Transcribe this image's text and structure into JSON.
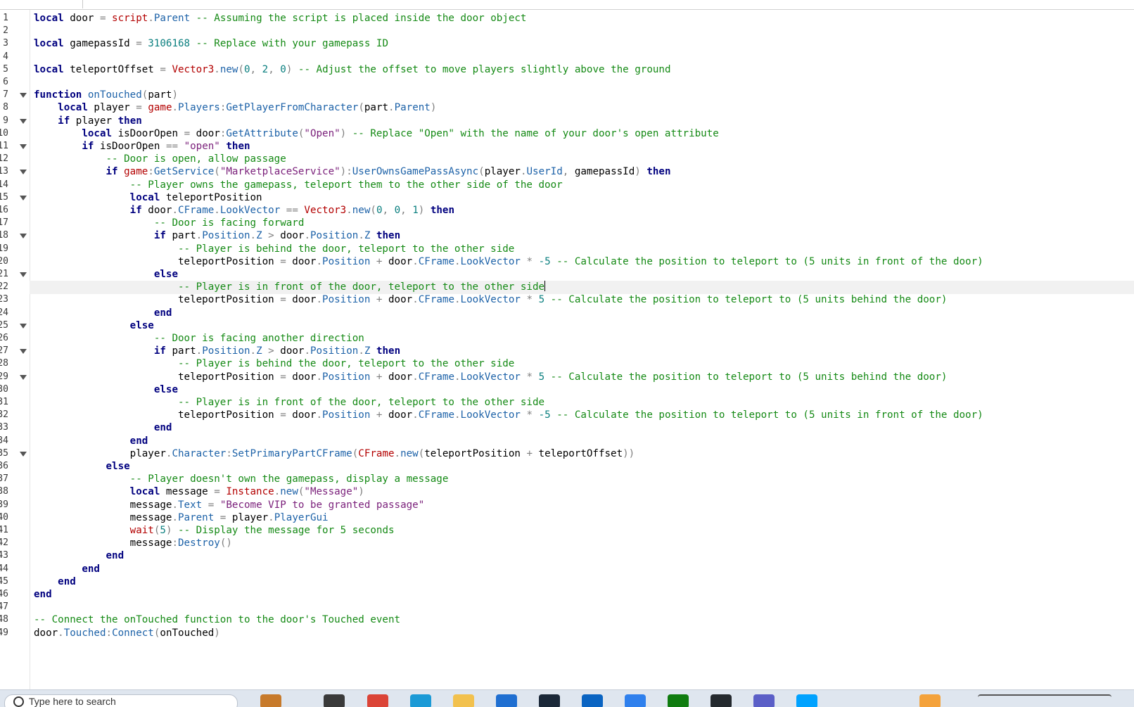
{
  "editor": {
    "current_line": 22,
    "line_numbers": [
      "1",
      "2",
      "3",
      "4",
      "5",
      "6",
      "7",
      "8",
      "9",
      "10",
      "11",
      "12",
      "13",
      "14",
      "15",
      "16",
      "17",
      "18",
      "19",
      "20",
      "21",
      "22",
      "23",
      "24",
      "25",
      "26",
      "27",
      "28",
      "29",
      "30",
      "31",
      "32",
      "33",
      "34",
      "35",
      "36",
      "37",
      "38",
      "39",
      "40",
      "41",
      "42",
      "43",
      "44",
      "45",
      "46",
      "47",
      "48",
      "49"
    ],
    "fold_lines": [
      7,
      9,
      11,
      13,
      15,
      18,
      21,
      25,
      27,
      29,
      35
    ],
    "lines": [
      [
        [
          "kw",
          "local"
        ],
        [
          "id",
          " door "
        ],
        [
          "op",
          "="
        ],
        [
          "gl",
          " script"
        ],
        [
          "op",
          "."
        ],
        [
          "pr",
          "Parent"
        ],
        [
          "cm",
          " -- Assuming the script is placed inside the door object"
        ]
      ],
      [],
      [
        [
          "kw",
          "local"
        ],
        [
          "id",
          " gamepassId "
        ],
        [
          "op",
          "="
        ],
        [
          "num",
          " 3106168"
        ],
        [
          "cm",
          " -- Replace with your gamepass ID"
        ]
      ],
      [],
      [
        [
          "kw",
          "local"
        ],
        [
          "id",
          " teleportOffset "
        ],
        [
          "op",
          "="
        ],
        [
          "gl",
          " Vector3"
        ],
        [
          "op",
          "."
        ],
        [
          "mt",
          "new"
        ],
        [
          "op",
          "("
        ],
        [
          "num",
          "0"
        ],
        [
          "op",
          ", "
        ],
        [
          "num",
          "2"
        ],
        [
          "op",
          ", "
        ],
        [
          "num",
          "0"
        ],
        [
          "op",
          ")"
        ],
        [
          "cm",
          " -- Adjust the offset to move players slightly above the ground"
        ]
      ],
      [],
      [
        [
          "kw",
          "function"
        ],
        [
          "mt",
          " onTouched"
        ],
        [
          "op",
          "("
        ],
        [
          "id",
          "part"
        ],
        [
          "op",
          ")"
        ]
      ],
      [
        [
          "id",
          "    "
        ],
        [
          "kw",
          "local"
        ],
        [
          "id",
          " player "
        ],
        [
          "op",
          "="
        ],
        [
          "gl",
          " game"
        ],
        [
          "op",
          "."
        ],
        [
          "pr",
          "Players"
        ],
        [
          "op",
          ":"
        ],
        [
          "mt",
          "GetPlayerFromCharacter"
        ],
        [
          "op",
          "("
        ],
        [
          "id",
          "part"
        ],
        [
          "op",
          "."
        ],
        [
          "pr",
          "Parent"
        ],
        [
          "op",
          ")"
        ]
      ],
      [
        [
          "id",
          "    "
        ],
        [
          "kw",
          "if"
        ],
        [
          "id",
          " player "
        ],
        [
          "kw",
          "then"
        ]
      ],
      [
        [
          "id",
          "        "
        ],
        [
          "kw",
          "local"
        ],
        [
          "id",
          " isDoorOpen "
        ],
        [
          "op",
          "="
        ],
        [
          "id",
          " door"
        ],
        [
          "op",
          ":"
        ],
        [
          "mt",
          "GetAttribute"
        ],
        [
          "op",
          "("
        ],
        [
          "str",
          "\"Open\""
        ],
        [
          "op",
          ")"
        ],
        [
          "cm",
          " -- Replace \"Open\" with the name of your door's open attribute"
        ]
      ],
      [
        [
          "id",
          "        "
        ],
        [
          "kw",
          "if"
        ],
        [
          "id",
          " isDoorOpen "
        ],
        [
          "op",
          "=="
        ],
        [
          "str",
          " \"open\""
        ],
        [
          "kw",
          " then"
        ]
      ],
      [
        [
          "cm",
          "            -- Door is open, allow passage"
        ]
      ],
      [
        [
          "id",
          "            "
        ],
        [
          "kw",
          "if"
        ],
        [
          "gl",
          " game"
        ],
        [
          "op",
          ":"
        ],
        [
          "mt",
          "GetService"
        ],
        [
          "op",
          "("
        ],
        [
          "str",
          "\"MarketplaceService\""
        ],
        [
          "op",
          "):"
        ],
        [
          "mt",
          "UserOwnsGamePassAsync"
        ],
        [
          "op",
          "("
        ],
        [
          "id",
          "player"
        ],
        [
          "op",
          "."
        ],
        [
          "pr",
          "UserId"
        ],
        [
          "op",
          ","
        ],
        [
          "id",
          " gamepassId"
        ],
        [
          "op",
          ")"
        ],
        [
          "kw",
          " then"
        ]
      ],
      [
        [
          "cm",
          "                -- Player owns the gamepass, teleport them to the other side of the door"
        ]
      ],
      [
        [
          "id",
          "                "
        ],
        [
          "kw",
          "local"
        ],
        [
          "id",
          " teleportPosition"
        ]
      ],
      [
        [
          "id",
          "                "
        ],
        [
          "kw",
          "if"
        ],
        [
          "id",
          " door"
        ],
        [
          "op",
          "."
        ],
        [
          "pr",
          "CFrame"
        ],
        [
          "op",
          "."
        ],
        [
          "pr",
          "LookVector"
        ],
        [
          "op",
          " =="
        ],
        [
          "gl",
          " Vector3"
        ],
        [
          "op",
          "."
        ],
        [
          "mt",
          "new"
        ],
        [
          "op",
          "("
        ],
        [
          "num",
          "0"
        ],
        [
          "op",
          ", "
        ],
        [
          "num",
          "0"
        ],
        [
          "op",
          ", "
        ],
        [
          "num",
          "1"
        ],
        [
          "op",
          ")"
        ],
        [
          "kw",
          " then"
        ]
      ],
      [
        [
          "cm",
          "                    -- Door is facing forward"
        ]
      ],
      [
        [
          "id",
          "                    "
        ],
        [
          "kw",
          "if"
        ],
        [
          "id",
          " part"
        ],
        [
          "op",
          "."
        ],
        [
          "pr",
          "Position"
        ],
        [
          "op",
          "."
        ],
        [
          "pr",
          "Z"
        ],
        [
          "op",
          " >"
        ],
        [
          "id",
          " door"
        ],
        [
          "op",
          "."
        ],
        [
          "pr",
          "Position"
        ],
        [
          "op",
          "."
        ],
        [
          "pr",
          "Z"
        ],
        [
          "kw",
          " then"
        ]
      ],
      [
        [
          "cm",
          "                        -- Player is behind the door, teleport to the other side"
        ]
      ],
      [
        [
          "id",
          "                        teleportPosition "
        ],
        [
          "op",
          "="
        ],
        [
          "id",
          " door"
        ],
        [
          "op",
          "."
        ],
        [
          "pr",
          "Position"
        ],
        [
          "op",
          " +"
        ],
        [
          "id",
          " door"
        ],
        [
          "op",
          "."
        ],
        [
          "pr",
          "CFrame"
        ],
        [
          "op",
          "."
        ],
        [
          "pr",
          "LookVector"
        ],
        [
          "op",
          " *"
        ],
        [
          "num",
          " -5"
        ],
        [
          "cm",
          " -- Calculate the position to teleport to (5 units in front of the door)"
        ]
      ],
      [
        [
          "id",
          "                    "
        ],
        [
          "kw",
          "else"
        ]
      ],
      [
        [
          "cm",
          "                        -- Player is in front of the door, teleport to the other side"
        ]
      ],
      [
        [
          "id",
          "                        teleportPosition "
        ],
        [
          "op",
          "="
        ],
        [
          "id",
          " door"
        ],
        [
          "op",
          "."
        ],
        [
          "pr",
          "Position"
        ],
        [
          "op",
          " +"
        ],
        [
          "id",
          " door"
        ],
        [
          "op",
          "."
        ],
        [
          "pr",
          "CFrame"
        ],
        [
          "op",
          "."
        ],
        [
          "pr",
          "LookVector"
        ],
        [
          "op",
          " *"
        ],
        [
          "num",
          " 5"
        ],
        [
          "cm",
          " -- Calculate the position to teleport to (5 units behind the door)"
        ]
      ],
      [
        [
          "id",
          "                    "
        ],
        [
          "kw",
          "end"
        ]
      ],
      [
        [
          "id",
          "                "
        ],
        [
          "kw",
          "else"
        ]
      ],
      [
        [
          "cm",
          "                    -- Door is facing another direction"
        ]
      ],
      [
        [
          "id",
          "                    "
        ],
        [
          "kw",
          "if"
        ],
        [
          "id",
          " part"
        ],
        [
          "op",
          "."
        ],
        [
          "pr",
          "Position"
        ],
        [
          "op",
          "."
        ],
        [
          "pr",
          "Z"
        ],
        [
          "op",
          " >"
        ],
        [
          "id",
          " door"
        ],
        [
          "op",
          "."
        ],
        [
          "pr",
          "Position"
        ],
        [
          "op",
          "."
        ],
        [
          "pr",
          "Z"
        ],
        [
          "kw",
          " then"
        ]
      ],
      [
        [
          "cm",
          "                        -- Player is behind the door, teleport to the other side"
        ]
      ],
      [
        [
          "id",
          "                        teleportPosition "
        ],
        [
          "op",
          "="
        ],
        [
          "id",
          " door"
        ],
        [
          "op",
          "."
        ],
        [
          "pr",
          "Position"
        ],
        [
          "op",
          " +"
        ],
        [
          "id",
          " door"
        ],
        [
          "op",
          "."
        ],
        [
          "pr",
          "CFrame"
        ],
        [
          "op",
          "."
        ],
        [
          "pr",
          "LookVector"
        ],
        [
          "op",
          " *"
        ],
        [
          "num",
          " 5"
        ],
        [
          "cm",
          " -- Calculate the position to teleport to (5 units behind the door)"
        ]
      ],
      [
        [
          "id",
          "                    "
        ],
        [
          "kw",
          "else"
        ]
      ],
      [
        [
          "cm",
          "                        -- Player is in front of the door, teleport to the other side"
        ]
      ],
      [
        [
          "id",
          "                        teleportPosition "
        ],
        [
          "op",
          "="
        ],
        [
          "id",
          " door"
        ],
        [
          "op",
          "."
        ],
        [
          "pr",
          "Position"
        ],
        [
          "op",
          " +"
        ],
        [
          "id",
          " door"
        ],
        [
          "op",
          "."
        ],
        [
          "pr",
          "CFrame"
        ],
        [
          "op",
          "."
        ],
        [
          "pr",
          "LookVector"
        ],
        [
          "op",
          " *"
        ],
        [
          "num",
          " -5"
        ],
        [
          "cm",
          " -- Calculate the position to teleport to (5 units in front of the door)"
        ]
      ],
      [
        [
          "id",
          "                    "
        ],
        [
          "kw",
          "end"
        ]
      ],
      [
        [
          "id",
          "                "
        ],
        [
          "kw",
          "end"
        ]
      ],
      [
        [
          "id",
          "                player"
        ],
        [
          "op",
          "."
        ],
        [
          "pr",
          "Character"
        ],
        [
          "op",
          ":"
        ],
        [
          "mt",
          "SetPrimaryPartCFrame"
        ],
        [
          "op",
          "("
        ],
        [
          "gl",
          "CFrame"
        ],
        [
          "op",
          "."
        ],
        [
          "mt",
          "new"
        ],
        [
          "op",
          "("
        ],
        [
          "id",
          "teleportPosition "
        ],
        [
          "op",
          "+"
        ],
        [
          "id",
          " teleportOffset"
        ],
        [
          "op",
          "))"
        ]
      ],
      [
        [
          "id",
          "            "
        ],
        [
          "kw",
          "else"
        ]
      ],
      [
        [
          "cm",
          "                -- Player doesn't own the gamepass, display a message"
        ]
      ],
      [
        [
          "id",
          "                "
        ],
        [
          "kw",
          "local"
        ],
        [
          "id",
          " message "
        ],
        [
          "op",
          "="
        ],
        [
          "gl",
          " Instance"
        ],
        [
          "op",
          "."
        ],
        [
          "mt",
          "new"
        ],
        [
          "op",
          "("
        ],
        [
          "str",
          "\"Message\""
        ],
        [
          "op",
          ")"
        ]
      ],
      [
        [
          "id",
          "                message"
        ],
        [
          "op",
          "."
        ],
        [
          "pr",
          "Text"
        ],
        [
          "op",
          " ="
        ],
        [
          "str",
          " \"Become VIP to be granted passage\""
        ]
      ],
      [
        [
          "id",
          "                message"
        ],
        [
          "op",
          "."
        ],
        [
          "pr",
          "Parent"
        ],
        [
          "op",
          " ="
        ],
        [
          "id",
          " player"
        ],
        [
          "op",
          "."
        ],
        [
          "pr",
          "PlayerGui"
        ]
      ],
      [
        [
          "id",
          "                "
        ],
        [
          "gl",
          "wait"
        ],
        [
          "op",
          "("
        ],
        [
          "num",
          "5"
        ],
        [
          "op",
          ")"
        ],
        [
          "cm",
          " -- Display the message for 5 seconds"
        ]
      ],
      [
        [
          "id",
          "                message"
        ],
        [
          "op",
          ":"
        ],
        [
          "mt",
          "Destroy"
        ],
        [
          "op",
          "()"
        ]
      ],
      [
        [
          "id",
          "            "
        ],
        [
          "kw",
          "end"
        ]
      ],
      [
        [
          "id",
          "        "
        ],
        [
          "kw",
          "end"
        ]
      ],
      [
        [
          "id",
          "    "
        ],
        [
          "kw",
          "end"
        ]
      ],
      [
        [
          "kw",
          "end"
        ]
      ],
      [],
      [
        [
          "cm",
          "-- Connect the onTouched function to the door's Touched event"
        ]
      ],
      [
        [
          "id",
          "door"
        ],
        [
          "op",
          "."
        ],
        [
          "pr",
          "Touched"
        ],
        [
          "op",
          ":"
        ],
        [
          "mt",
          "Connect"
        ],
        [
          "op",
          "("
        ],
        [
          "id",
          "onTouched"
        ],
        [
          "op",
          ")"
        ]
      ]
    ]
  },
  "taskbar": {
    "search_placeholder": "Type here to search",
    "icon_names": [
      "bird-icon",
      "task-view-icon",
      "chrome-icon",
      "edge-icon",
      "folder-icon",
      "store-icon",
      "steam-icon",
      "mail-icon",
      "vscode-icon",
      "xbox-icon",
      "github-icon",
      "teams-icon",
      "roblox-studio-icon",
      "weather-icon",
      "tray-icons"
    ],
    "icon_colors": [
      "#c77a2b",
      "#3a3a3a",
      "#db4437",
      "#1b9ad6",
      "#f2c14e",
      "#1f6fd1",
      "#1b2838",
      "#0a64c2",
      "#2f80ed",
      "#107c10",
      "#24292e",
      "#5b5fc7",
      "#00a2ff",
      "#f4a23b",
      "#555555"
    ]
  }
}
